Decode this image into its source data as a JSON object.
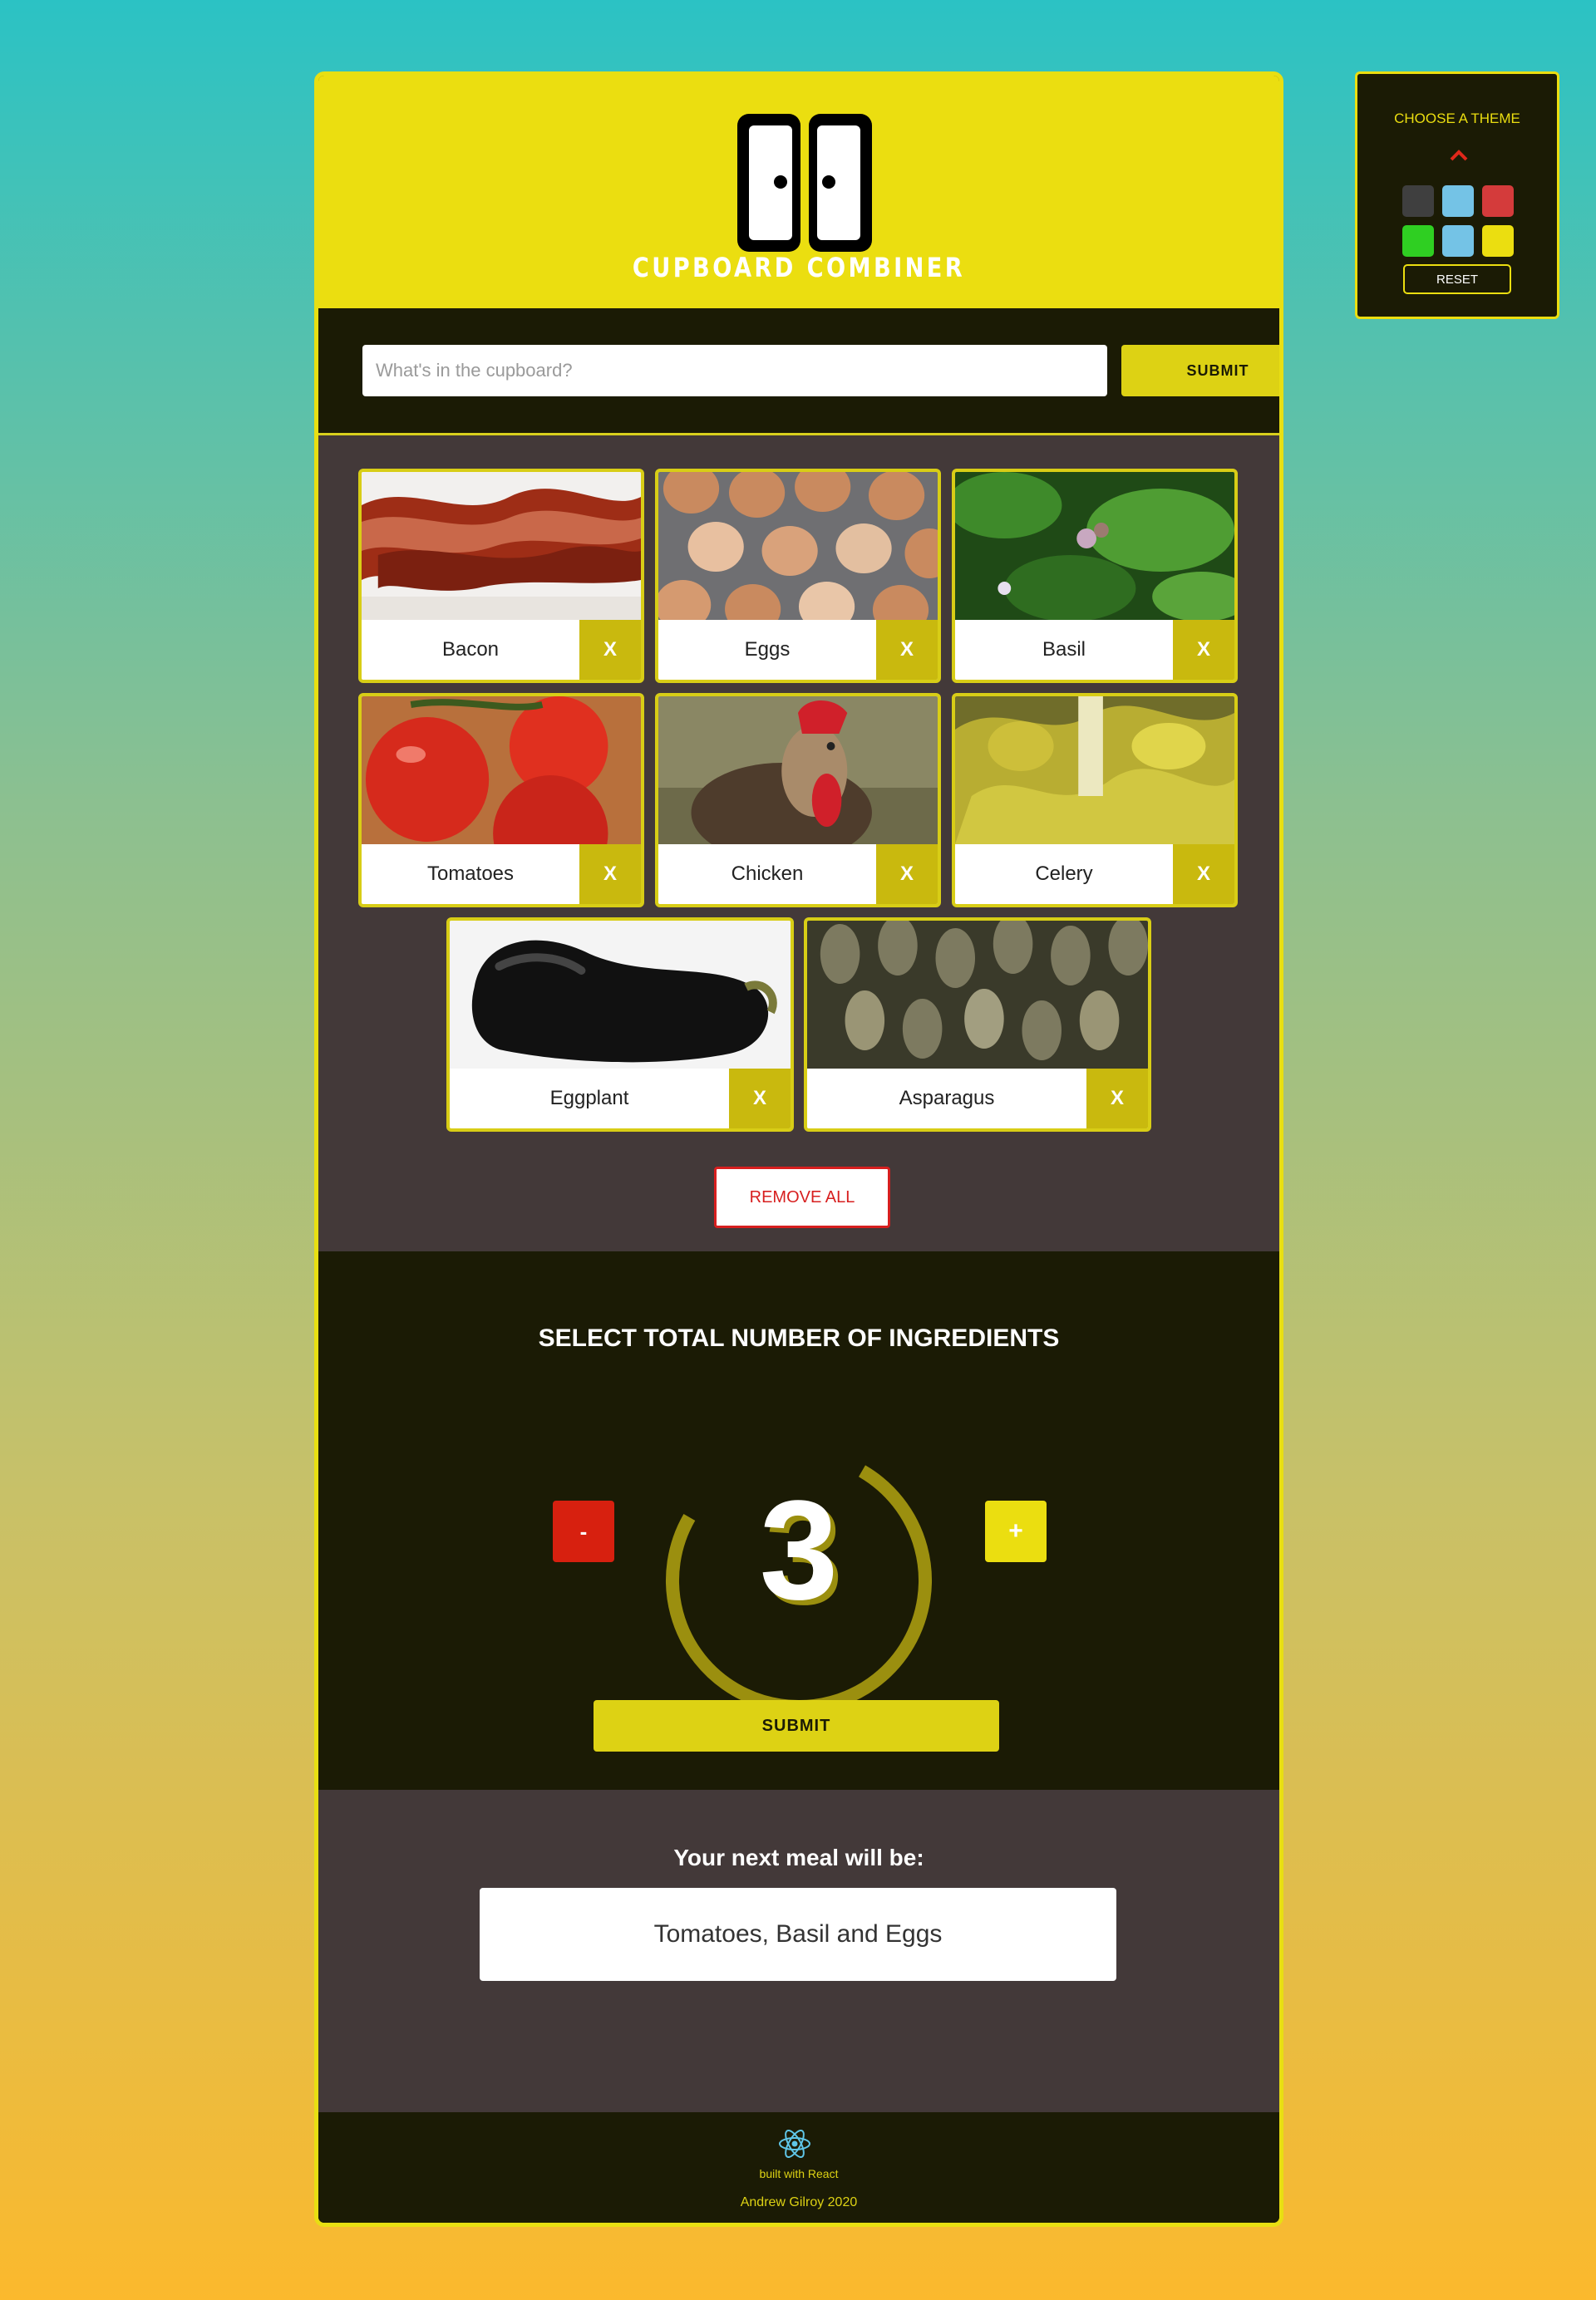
{
  "header": {
    "logo_text": "CUPBOARD COMBINER"
  },
  "search": {
    "placeholder": "What's in the cupboard?",
    "submit_label": "SUBMIT"
  },
  "ingredients": [
    {
      "name": "Bacon",
      "remove_label": "X",
      "image": "bacon"
    },
    {
      "name": "Eggs",
      "remove_label": "X",
      "image": "eggs"
    },
    {
      "name": "Basil",
      "remove_label": "X",
      "image": "basil"
    },
    {
      "name": "Tomatoes",
      "remove_label": "X",
      "image": "tomatoes"
    },
    {
      "name": "Chicken",
      "remove_label": "X",
      "image": "chicken"
    },
    {
      "name": "Celery",
      "remove_label": "X",
      "image": "celery"
    },
    {
      "name": "Eggplant",
      "remove_label": "X",
      "image": "eggplant"
    },
    {
      "name": "Asparagus",
      "remove_label": "X",
      "image": "asparagus"
    }
  ],
  "remove_all_label": "REMOVE ALL",
  "selector": {
    "title": "SELECT TOTAL NUMBER OF INGREDIENTS",
    "minus_label": "-",
    "plus_label": "+",
    "count": "3",
    "gauge_fraction": 0.75,
    "submit_label": "SUBMIT"
  },
  "result": {
    "title": "Your next meal will be:",
    "meal": "Tomatoes, Basil and Eggs"
  },
  "footer": {
    "built_with": "built with React",
    "author": "Andrew Gilroy 2020"
  },
  "theme_panel": {
    "title": "CHOOSE A THEME",
    "reset_label": "RESET",
    "swatches": [
      "#3f3f3f",
      "#74c3e6",
      "#d43b3b",
      "#2fcf22",
      "#74c3e6",
      "#ebde10"
    ]
  },
  "colors": {
    "accent": "#ebde10",
    "dark": "#1b1b05",
    "panel": "#433939",
    "danger": "#d7200f"
  }
}
